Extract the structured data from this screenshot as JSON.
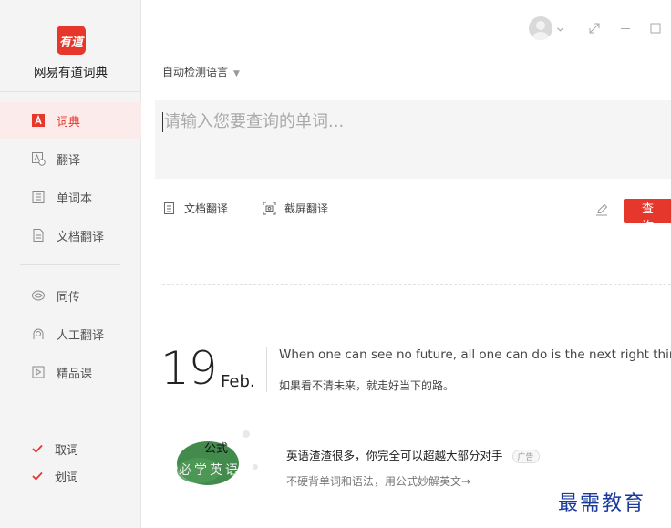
{
  "app": {
    "logo_text": "有道",
    "brand": "网易有道词典"
  },
  "sidebar": {
    "items": [
      {
        "label": "词典",
        "icon": "dict-icon",
        "active": true
      },
      {
        "label": "翻译",
        "icon": "translate-icon",
        "active": false
      },
      {
        "label": "单词本",
        "icon": "wordbook-icon",
        "active": false
      },
      {
        "label": "文档翻译",
        "icon": "document-icon",
        "active": false
      },
      {
        "label": "同传",
        "icon": "interpret-icon",
        "active": false
      },
      {
        "label": "人工翻译",
        "icon": "human-translate-icon",
        "active": false
      },
      {
        "label": "精品课",
        "icon": "course-icon",
        "active": false
      }
    ],
    "checks": [
      {
        "label": "取词",
        "checked": true
      },
      {
        "label": "划词",
        "checked": true
      }
    ]
  },
  "main": {
    "language_select": "自动检测语言",
    "query_placeholder": "请输入您要查询的单词...",
    "tools": {
      "doc_translate": "文档翻译",
      "screenshot_translate": "截屏翻译"
    },
    "search_button": "查询"
  },
  "daily": {
    "day": "19",
    "month": "Feb.",
    "quote_en": "When one can see no future, all one can do is the next right thing.",
    "quote_cn": "如果看不清未来，就走好当下的路。"
  },
  "ad": {
    "image_text_top": "公式",
    "image_text_bottom": "必学英语",
    "title": "英语渣渣很多，你完全可以超越大部分对手",
    "badge": "广告",
    "subtitle": "不硬背单词和语法，用公式妙解英文→"
  },
  "watermark": "最需教育",
  "colors": {
    "accent": "#e5372b",
    "sidebar_bg": "#f4f4f4",
    "active_bg": "#fbeceb"
  }
}
